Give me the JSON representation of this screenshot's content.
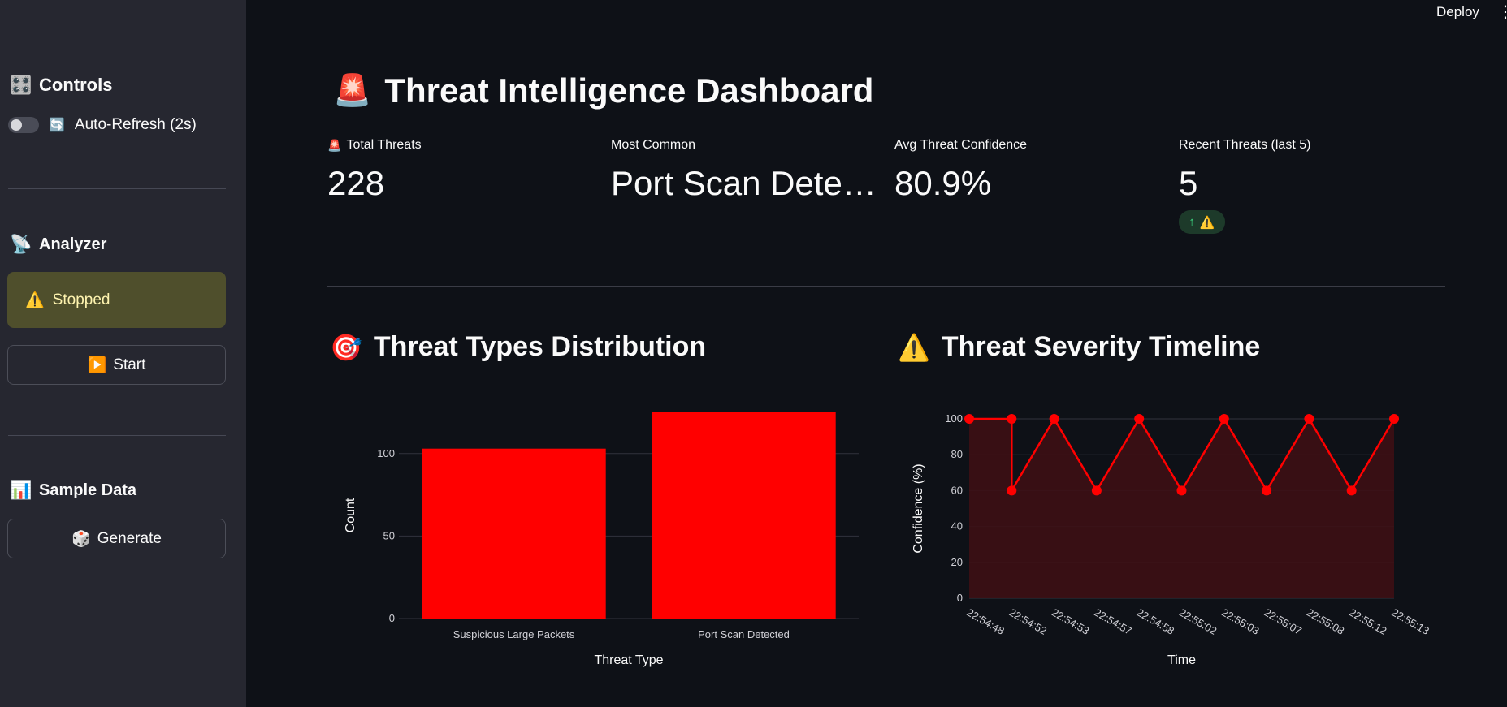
{
  "header": {
    "deploy_label": "Deploy",
    "menu_icon": "kebab-menu-icon"
  },
  "sidebar": {
    "controls": {
      "title": "Controls",
      "icon": "control-knobs-icon"
    },
    "auto_refresh": {
      "label": "Auto-Refresh (2s)",
      "enabled": false,
      "icon": "refresh-icon"
    },
    "analyzer": {
      "title": "Analyzer",
      "icon": "satellite-antenna-icon"
    },
    "status": {
      "text": "Stopped",
      "icon": "warning-icon"
    },
    "start_button": {
      "label": "Start",
      "icon": "play-button-icon"
    },
    "sample_data": {
      "title": "Sample Data",
      "icon": "bar-chart-icon"
    },
    "generate_button": {
      "label": "Generate",
      "icon": "dice-icon"
    }
  },
  "page": {
    "title": "Threat Intelligence Dashboard",
    "icon": "siren-icon"
  },
  "metrics": [
    {
      "label": "Total Threats",
      "value": "228",
      "icon": "siren-icon"
    },
    {
      "label": "Most Common",
      "value": "Port Scan Dete…"
    },
    {
      "label": "Avg Threat Confidence",
      "value": "80.9%"
    },
    {
      "label": "Recent Threats (last 5)",
      "value": "5",
      "delta": "⚠️",
      "delta_direction": "up"
    }
  ],
  "sections": {
    "distribution": {
      "title": "Threat Types Distribution",
      "icon": "direct-hit-icon"
    },
    "timeline": {
      "title": "Threat Severity Timeline",
      "icon": "warning-icon"
    }
  },
  "chart_data": [
    {
      "type": "bar",
      "categories": [
        "Suspicious Large Packets",
        "Port Scan Detected"
      ],
      "values": [
        103,
        125
      ],
      "xlabel": "Threat Type",
      "ylabel": "Count",
      "ylim": [
        0,
        125
      ],
      "yticks": [
        0,
        50,
        100
      ],
      "grid": true,
      "color": "#ff0000"
    },
    {
      "type": "area",
      "x": [
        "22:54:48",
        "22:54:52",
        "22:54:52",
        "22:54:53",
        "22:54:57",
        "22:54:58",
        "22:55:02",
        "22:55:03",
        "22:55:07",
        "22:55:08",
        "22:55:12",
        "22:55:13"
      ],
      "xticks": [
        "22:54:48",
        "22:54:52",
        "22:54:53",
        "22:54:57",
        "22:54:58",
        "22:55:02",
        "22:55:03",
        "22:55:07",
        "22:55:08",
        "22:55:12",
        "22:55:13"
      ],
      "values": [
        100,
        100,
        60,
        100,
        60,
        100,
        60,
        100,
        60,
        100,
        60,
        100
      ],
      "xlabel": "Time",
      "ylabel": "Confidence (%)",
      "ylim": [
        0,
        100
      ],
      "yticks": [
        0,
        20,
        40,
        60,
        80,
        100
      ],
      "grid": true,
      "color": "#ff0000",
      "fill_color": "#3d1014"
    }
  ]
}
